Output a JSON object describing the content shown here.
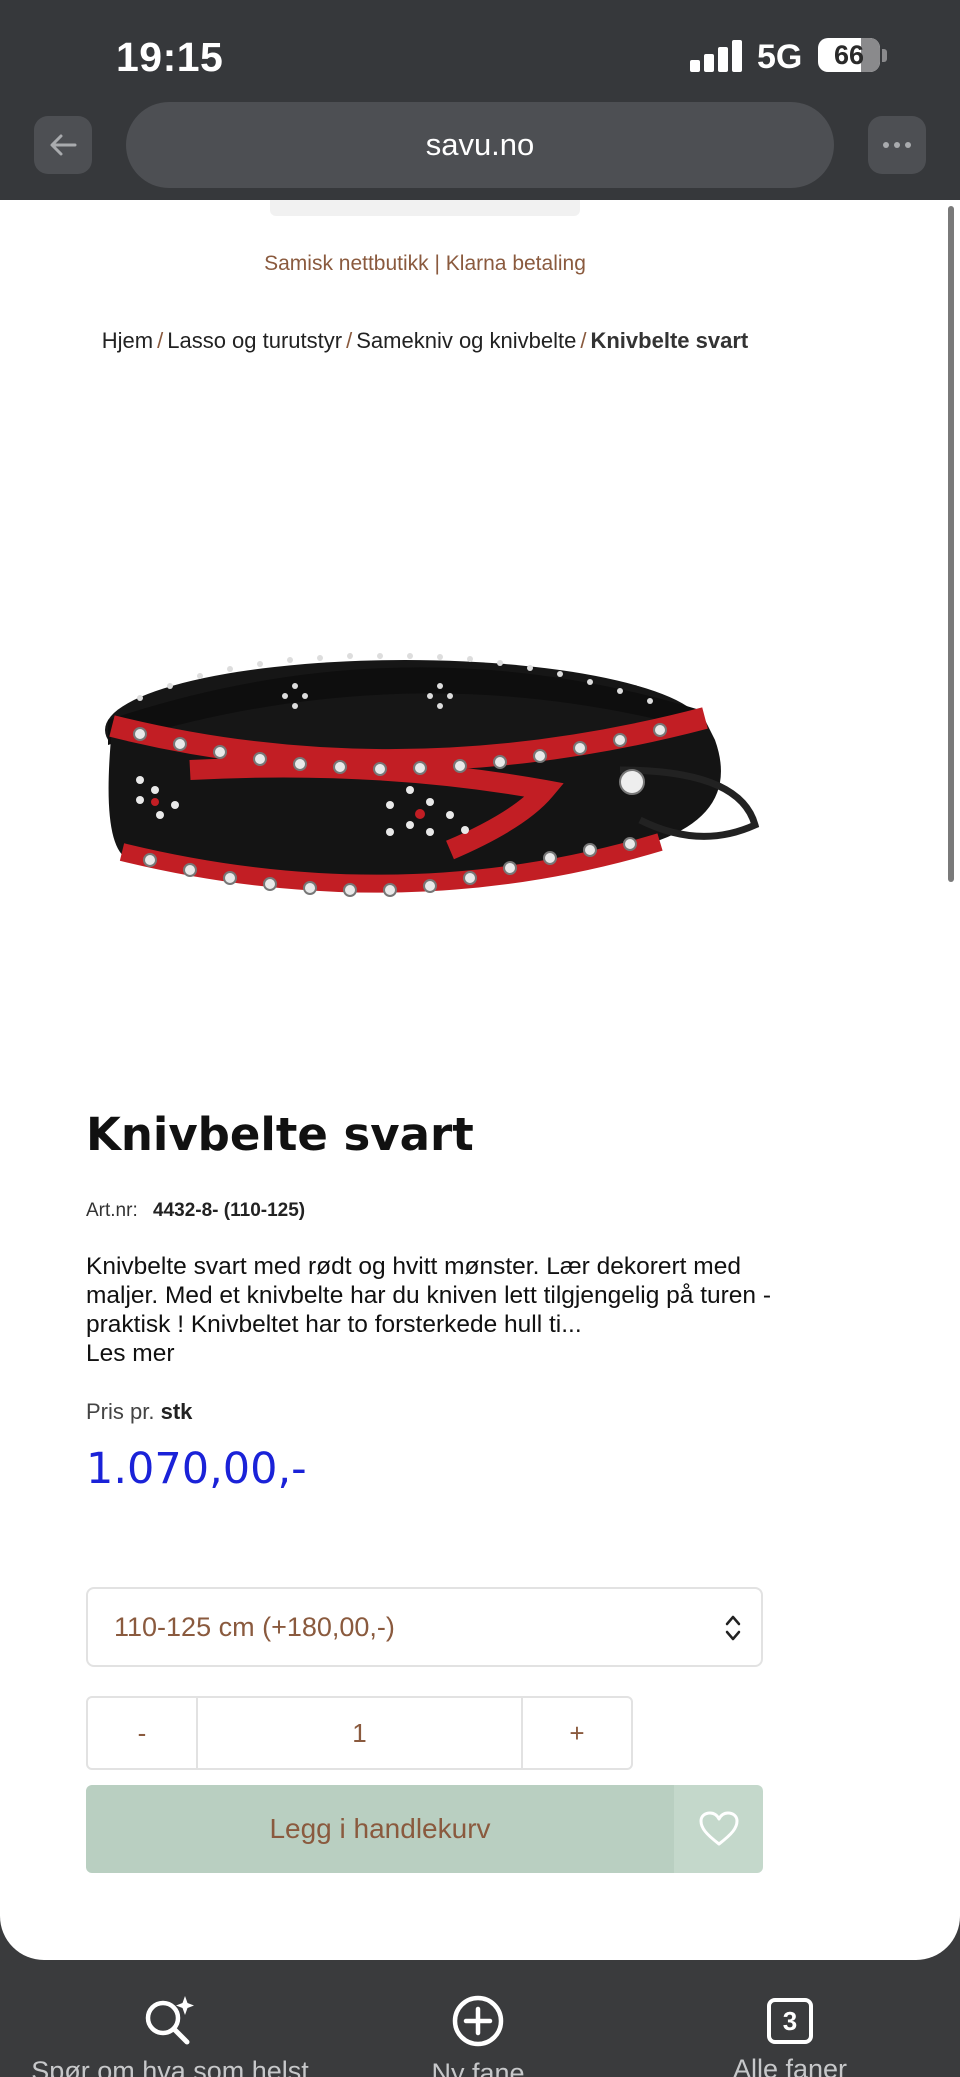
{
  "status_bar": {
    "time": "19:15",
    "network": "5G",
    "battery": "66"
  },
  "browser": {
    "url": "savu.no",
    "back_icon": "arrow-left-icon",
    "more_icon": "ellipsis-icon"
  },
  "site": {
    "tagline": "Samisk nettbutikk | Klarna betaling"
  },
  "breadcrumb": {
    "items": [
      "Hjem",
      "Lasso og turutstyr",
      "Samekniv og knivbelte",
      "Knivbelte svart"
    ],
    "separator": "/"
  },
  "product": {
    "title": "Knivbelte svart",
    "artnr_label": "Art.nr:",
    "artnr_value": "4432-8- (110-125)",
    "description": "Knivbelte svart med rødt og hvitt mønster. Lær dekorert med maljer. Med et knivbelte har du kniven lett tilgjengelig på turen - praktisk !     Knivbeltet har to forsterkede hull ti...",
    "read_more": "Les mer",
    "price_unit_label": "Pris pr.",
    "price_unit": "stk",
    "price": "1.070,00,-",
    "variant_selected": "110-125 cm (+180,00,-)",
    "quantity": "1",
    "qty_minus": "-",
    "qty_plus": "+",
    "add_to_cart": "Legg i handlekurv",
    "wishlist_icon": "heart-icon"
  },
  "colors": {
    "accent_brown": "#8a5a3e",
    "price_blue": "#1a22d8",
    "cart_green": "#b9cfc1"
  },
  "toolbar": {
    "ask": "Spør om hva som helst",
    "new_tab": "Ny fane",
    "all_tabs": "Alle faner",
    "tab_count": "3"
  }
}
